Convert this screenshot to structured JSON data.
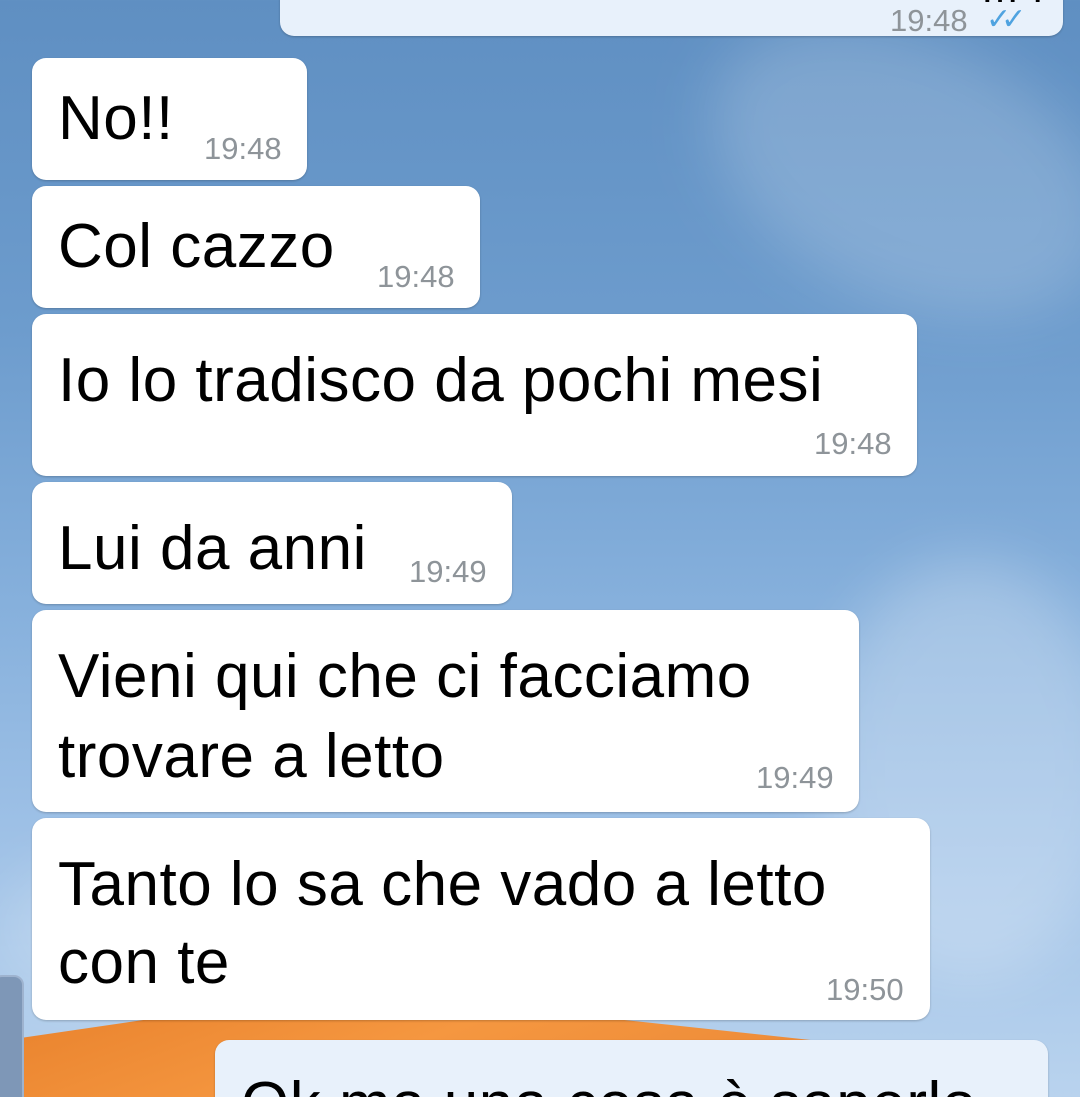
{
  "conversation": {
    "messages": [
      {
        "direction": "outgoing",
        "lines": [
          "… ."
        ],
        "time": "19:48",
        "status": "read",
        "partially_visible": true
      },
      {
        "direction": "incoming",
        "lines": [
          "No!!"
        ],
        "time": "19:48"
      },
      {
        "direction": "incoming",
        "lines": [
          "Col cazzo"
        ],
        "time": "19:48"
      },
      {
        "direction": "incoming",
        "lines": [
          "Io lo tradisco da pochi mesi"
        ],
        "time": "19:48"
      },
      {
        "direction": "incoming",
        "lines": [
          "Lui da anni"
        ],
        "time": "19:49"
      },
      {
        "direction": "incoming",
        "lines": [
          "Vieni qui che ci facciamo",
          "trovare a letto"
        ],
        "time": "19:49"
      },
      {
        "direction": "incoming",
        "lines": [
          "Tanto lo sa che vado a letto",
          "con te"
        ],
        "time": "19:50"
      },
      {
        "direction": "outgoing",
        "lines": [
          "Ok ma una cosa è saperlo"
        ],
        "partially_visible": true
      }
    ]
  },
  "icons": {
    "read_receipt": "double-check-icon"
  },
  "colors": {
    "incoming_bubble": "#ffffff",
    "outgoing_bubble": "#e8f1fb",
    "timestamp": "#8e9499",
    "read_check": "#4fa3e0"
  }
}
